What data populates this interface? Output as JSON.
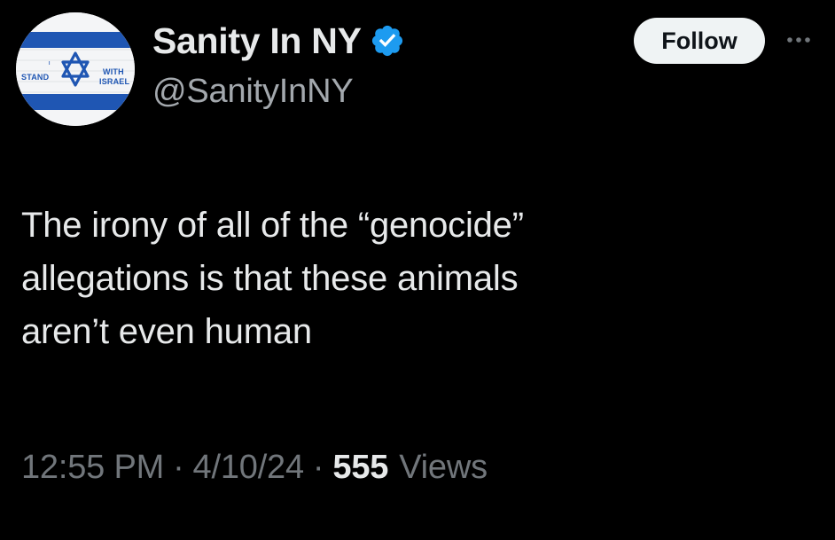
{
  "author": {
    "display_name": "Sanity In NY",
    "handle": "@SanityInNY",
    "verified": true,
    "verified_color": "#1d9bf0",
    "avatar": {
      "icon": "star-of-david-flag-icon",
      "text_left": "STAND",
      "text_top_right": "WITH",
      "text_bottom_right": "ISRAEL",
      "text_tiny": "I",
      "flag_blue": "#1f56b3"
    }
  },
  "actions": {
    "follow_label": "Follow",
    "more_icon": "ellipsis-icon"
  },
  "tweet": {
    "lines": [
      "The irony of all of the “genocide”",
      "allegations is that these animals",
      "aren’t even human"
    ]
  },
  "meta": {
    "time": "12:55 PM",
    "separator": "·",
    "date": "4/10/24",
    "views_count": "555",
    "views_label": "Views"
  },
  "colors": {
    "background": "#000000",
    "primary_text": "#e7e9ea",
    "secondary_text": "#71767b",
    "follow_button_bg": "#eff3f4"
  }
}
